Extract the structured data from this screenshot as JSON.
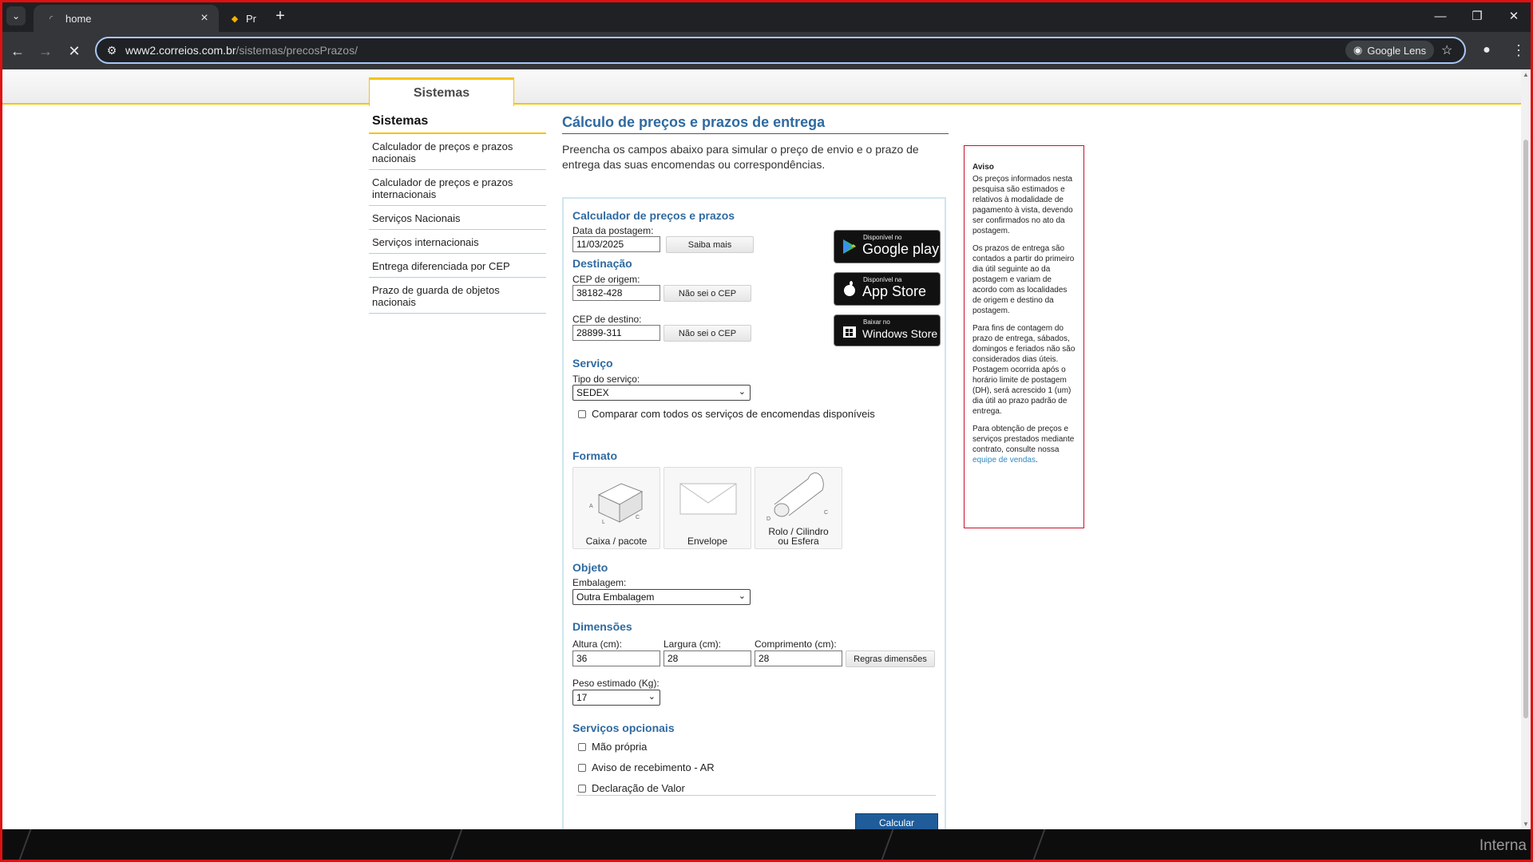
{
  "browser": {
    "tabs": [
      {
        "title": "home",
        "active": true
      },
      {
        "title": "Pr",
        "active": false
      }
    ],
    "url_host": "www2.correios.com.br",
    "url_path": "/sistemas/precosPrazos/",
    "lens_label": "Google Lens"
  },
  "page": {
    "top_tab_label": "Sistemas",
    "sidebar": {
      "title": "Sistemas",
      "items": [
        {
          "label": "Calculador de preços e prazos nacionais"
        },
        {
          "label": "Calculador de preços e prazos internacionais"
        },
        {
          "label": "Serviços Nacionais"
        },
        {
          "label": "Serviços internacionais"
        },
        {
          "label": "Entrega diferenciada por CEP"
        },
        {
          "label": "Prazo de guarda de objetos nacionais"
        }
      ]
    },
    "main": {
      "title": "Cálculo de preços e prazos de entrega",
      "intro": "Preencha os campos abaixo para simular o preço de envio e o prazo de entrega das suas encomendas ou correspondências."
    },
    "calculator": {
      "header": "Calculador de preços e prazos",
      "data_postagem_label": "Data da postagem:",
      "data_postagem_value": "11/03/2025",
      "saiba_mais": "Saiba mais",
      "destinacao": "Destinação",
      "cep_origem_label": "CEP de origem:",
      "cep_origem_value": "38182-428",
      "cep_destino_label": "CEP de destino:",
      "cep_destino_value": "28899-311",
      "nao_sei_cep": "Não sei o CEP",
      "servico": "Serviço",
      "tipo_servico_label": "Tipo do serviço:",
      "tipo_servico_value": "SEDEX",
      "comparar_label": "Comparar com todos os serviços de encomendas disponíveis",
      "formato": "Formato",
      "formatos": {
        "caixa": "Caixa / pacote",
        "envelope": "Envelope",
        "rolo_1": "Rolo / Cilindro",
        "rolo_2": "ou Esfera"
      },
      "objeto": "Objeto",
      "embalagem_label": "Embalagem:",
      "embalagem_value": "Outra Embalagem",
      "dimensoes": "Dimensões",
      "altura_label": "Altura (cm):",
      "altura_value": "36",
      "largura_label": "Largura (cm):",
      "largura_value": "28",
      "comprimento_label": "Comprimento (cm):",
      "comprimento_value": "28",
      "regras_dimensoes": "Regras dimensões",
      "peso_label": "Peso estimado (Kg):",
      "peso_value": "17",
      "servicos_opcionais": "Serviços opcionais",
      "opcionais": [
        {
          "label": "Mão própria"
        },
        {
          "label": "Aviso de recebimento - AR"
        },
        {
          "label": "Declaração de Valor"
        }
      ],
      "calcular": "Calcular"
    },
    "stores": {
      "google_small": "Disponível no",
      "google_big": "Google play",
      "apple_small": "Disponível na",
      "apple_big": "App Store",
      "windows_small": "Baixar no",
      "windows_big": "Windows Store"
    },
    "aviso": {
      "title": "Aviso",
      "p1": "Os preços informados nesta pesquisa são estimados e relativos à modalidade de pagamento à vista, devendo ser confirmados no ato da postagem.",
      "p2": "Os prazos de entrega são contados a partir do primeiro dia útil seguinte ao da postagem e variam de acordo com as localidades de origem e destino da postagem.",
      "p3": "Para fins de contagem do prazo de entrega, sábados, domingos e feriados não são considerados dias úteis. Postagem ocorrida após o horário limite de postagem (DH), será acrescido 1 (um) dia útil ao prazo padrão de entrega.",
      "p4": "Para obtenção de preços e serviços prestados mediante contrato, consulte nossa",
      "p4_link": "equipe de vendas",
      "p4_end": "."
    }
  },
  "taskbar": {
    "watermark": "Interna"
  }
}
